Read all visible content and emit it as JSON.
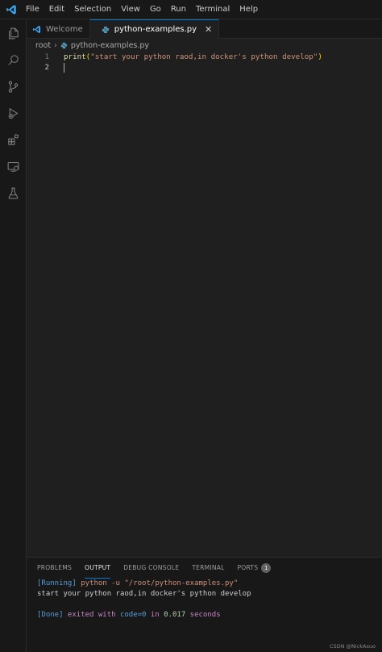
{
  "menu": [
    "File",
    "Edit",
    "Selection",
    "View",
    "Go",
    "Run",
    "Terminal",
    "Help"
  ],
  "tabs": {
    "welcome": "Welcome",
    "file": "python-examples.py",
    "close_glyph": "✕"
  },
  "breadcrumb": {
    "root": "root",
    "sep": "›",
    "file": "python-examples.py"
  },
  "editor": {
    "line1_no": "1",
    "line2_no": "2",
    "line1": {
      "fn": "print",
      "open": "(",
      "str": "\"start your python raod,in docker's python develop\"",
      "close": ")"
    }
  },
  "panel": {
    "tabs": [
      "PROBLEMS",
      "OUTPUT",
      "DEBUG CONSOLE",
      "TERMINAL",
      "PORTS"
    ],
    "ports_badge": "1",
    "output": {
      "running_tag": "[Running]",
      "running_cmd": " python -u \"/root/python-examples.py\"",
      "result": "start your python raod,in docker's python develop",
      "done_tag": "[Done]",
      "done_pre": " exited with ",
      "done_code": "code=0",
      "done_in": " in ",
      "done_time": "0.017",
      "done_seconds": " seconds"
    }
  },
  "watermark": "CSDN @NickAsuo",
  "colors": {
    "accent": "#0078d4",
    "vscode_logo": "#3aa0e8"
  }
}
